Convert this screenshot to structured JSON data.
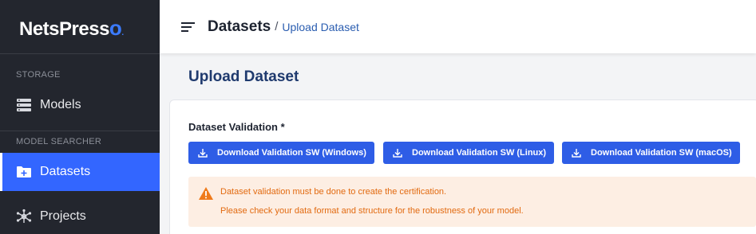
{
  "app": {
    "logo_text": "NetsPress",
    "logo_suffix": "o"
  },
  "sidebar": {
    "sections": [
      {
        "label": "STORAGE"
      },
      {
        "label": "MODEL SEARCHER"
      }
    ],
    "items": [
      {
        "label": "Models",
        "icon": "server-stack-icon",
        "active": false
      },
      {
        "label": "Datasets",
        "icon": "folder-plus-icon",
        "active": true
      },
      {
        "label": "Projects",
        "icon": "network-icon",
        "active": false
      }
    ]
  },
  "header": {
    "breadcrumb_main": "Datasets",
    "breadcrumb_sep": "/",
    "breadcrumb_sub": "Upload Dataset"
  },
  "main": {
    "title": "Upload Dataset",
    "field_label": "Dataset Validation *",
    "buttons": [
      {
        "label": "Download Validation SW (Windows)"
      },
      {
        "label": "Download Validation SW (Linux)"
      },
      {
        "label": "Download Validation SW (macOS)"
      }
    ],
    "alert": {
      "line1": "Dataset validation must be done to create the certification.",
      "line2": "Please check your data format and structure for the robustness of your model."
    }
  },
  "colors": {
    "sidebar_bg": "#23262e",
    "accent": "#3366ff",
    "button": "#2e5de6",
    "alert_bg": "#fdeee3",
    "alert_text": "#e26a10"
  }
}
